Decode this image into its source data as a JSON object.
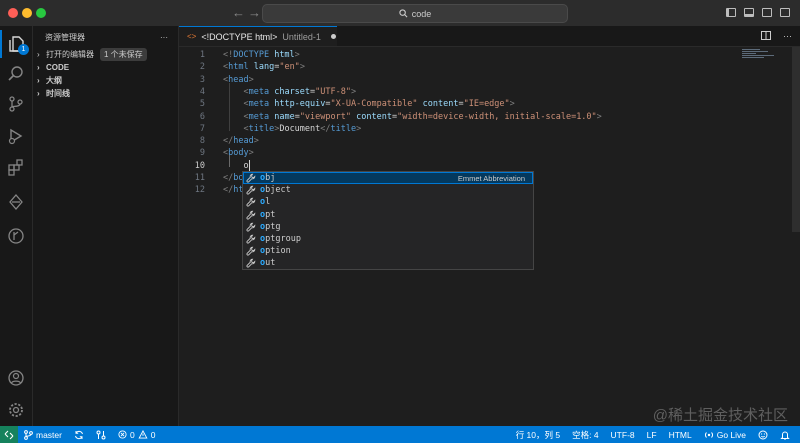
{
  "titlebar": {
    "search_text": "code",
    "back_arrow": "←",
    "forward_arrow": "→"
  },
  "sidebar": {
    "title": "资源管理器",
    "more": "···",
    "sections": [
      {
        "label": "打开的编辑器",
        "badge": "1 个未保存",
        "bold": false
      },
      {
        "label": "CODE",
        "bold": true
      },
      {
        "label": "大纲",
        "bold": true
      },
      {
        "label": "时间线",
        "bold": true
      }
    ]
  },
  "activity": {
    "explorer_badge": "1"
  },
  "tab": {
    "icon": "<>",
    "title": "<!DOCTYPE html>",
    "subtitle": "Untitled-1"
  },
  "editor": {
    "lines": [
      {
        "n": "1",
        "indent": "",
        "parts": [
          [
            "tg",
            "<!"
          ],
          [
            "tn",
            "DOCTYPE"
          ],
          [
            "an",
            " html"
          ],
          [
            "tg",
            ">"
          ]
        ]
      },
      {
        "n": "2",
        "indent": "",
        "parts": [
          [
            "tg",
            "<"
          ],
          [
            "tn",
            "html"
          ],
          [
            "an",
            " lang"
          ],
          [
            "tx",
            "="
          ],
          [
            "av",
            "\"en\""
          ],
          [
            "tg",
            ">"
          ]
        ]
      },
      {
        "n": "3",
        "indent": "",
        "parts": [
          [
            "tg",
            "<"
          ],
          [
            "tn",
            "head"
          ],
          [
            "tg",
            ">"
          ]
        ]
      },
      {
        "n": "4",
        "indent": "    ",
        "parts": [
          [
            "tg",
            "<"
          ],
          [
            "tn",
            "meta"
          ],
          [
            "an",
            " charset"
          ],
          [
            "tx",
            "="
          ],
          [
            "av",
            "\"UTF-8\""
          ],
          [
            "tg",
            ">"
          ]
        ]
      },
      {
        "n": "5",
        "indent": "    ",
        "parts": [
          [
            "tg",
            "<"
          ],
          [
            "tn",
            "meta"
          ],
          [
            "an",
            " http-equiv"
          ],
          [
            "tx",
            "="
          ],
          [
            "av",
            "\"X-UA-Compatible\""
          ],
          [
            "an",
            " content"
          ],
          [
            "tx",
            "="
          ],
          [
            "av",
            "\"IE=edge\""
          ],
          [
            "tg",
            ">"
          ]
        ]
      },
      {
        "n": "6",
        "indent": "    ",
        "parts": [
          [
            "tg",
            "<"
          ],
          [
            "tn",
            "meta"
          ],
          [
            "an",
            " name"
          ],
          [
            "tx",
            "="
          ],
          [
            "av",
            "\"viewport\""
          ],
          [
            "an",
            " content"
          ],
          [
            "tx",
            "="
          ],
          [
            "av",
            "\"width=device-width, initial-scale=1.0\""
          ],
          [
            "tg",
            ">"
          ]
        ]
      },
      {
        "n": "7",
        "indent": "    ",
        "parts": [
          [
            "tg",
            "<"
          ],
          [
            "tn",
            "title"
          ],
          [
            "tg",
            ">"
          ],
          [
            "tx",
            "Document"
          ],
          [
            "tg",
            "</"
          ],
          [
            "tn",
            "title"
          ],
          [
            "tg",
            ">"
          ]
        ]
      },
      {
        "n": "8",
        "indent": "",
        "parts": [
          [
            "tg",
            "</"
          ],
          [
            "tn",
            "head"
          ],
          [
            "tg",
            ">"
          ]
        ]
      },
      {
        "n": "9",
        "indent": "",
        "parts": [
          [
            "tg",
            "<"
          ],
          [
            "tn",
            "body"
          ],
          [
            "tg",
            ">"
          ]
        ]
      },
      {
        "n": "10",
        "indent": "    ",
        "parts": [
          [
            "tx",
            "o"
          ]
        ],
        "cursor": true
      },
      {
        "n": "11",
        "indent": "",
        "parts": [
          [
            "tg",
            "</"
          ],
          [
            "tn",
            "bo"
          ]
        ]
      },
      {
        "n": "12",
        "indent": "",
        "parts": [
          [
            "tg",
            "</"
          ],
          [
            "tn",
            "ht"
          ]
        ]
      }
    ]
  },
  "suggestions": {
    "selected_detail": "Emmet Abbreviation",
    "items": [
      {
        "match": "o",
        "rest": "bj"
      },
      {
        "match": "o",
        "rest": "bject"
      },
      {
        "match": "o",
        "rest": "l"
      },
      {
        "match": "o",
        "rest": "pt"
      },
      {
        "match": "o",
        "rest": "ptg"
      },
      {
        "match": "o",
        "rest": "ptgroup"
      },
      {
        "match": "o",
        "rest": "ption"
      },
      {
        "match": "o",
        "rest": "ut"
      }
    ]
  },
  "statusbar": {
    "branch": "master",
    "errors": "0",
    "warnings": "0",
    "position": "行 10，列 5",
    "spaces": "空格: 4",
    "encoding": "UTF-8",
    "eol": "LF",
    "language": "HTML",
    "golive": "Go Live"
  },
  "watermark": "@稀土掘金技术社区",
  "colors": {
    "accent": "#0078d4",
    "statusbar": "#0078d4",
    "selection": "#04395e",
    "match": "#2aaaff"
  }
}
